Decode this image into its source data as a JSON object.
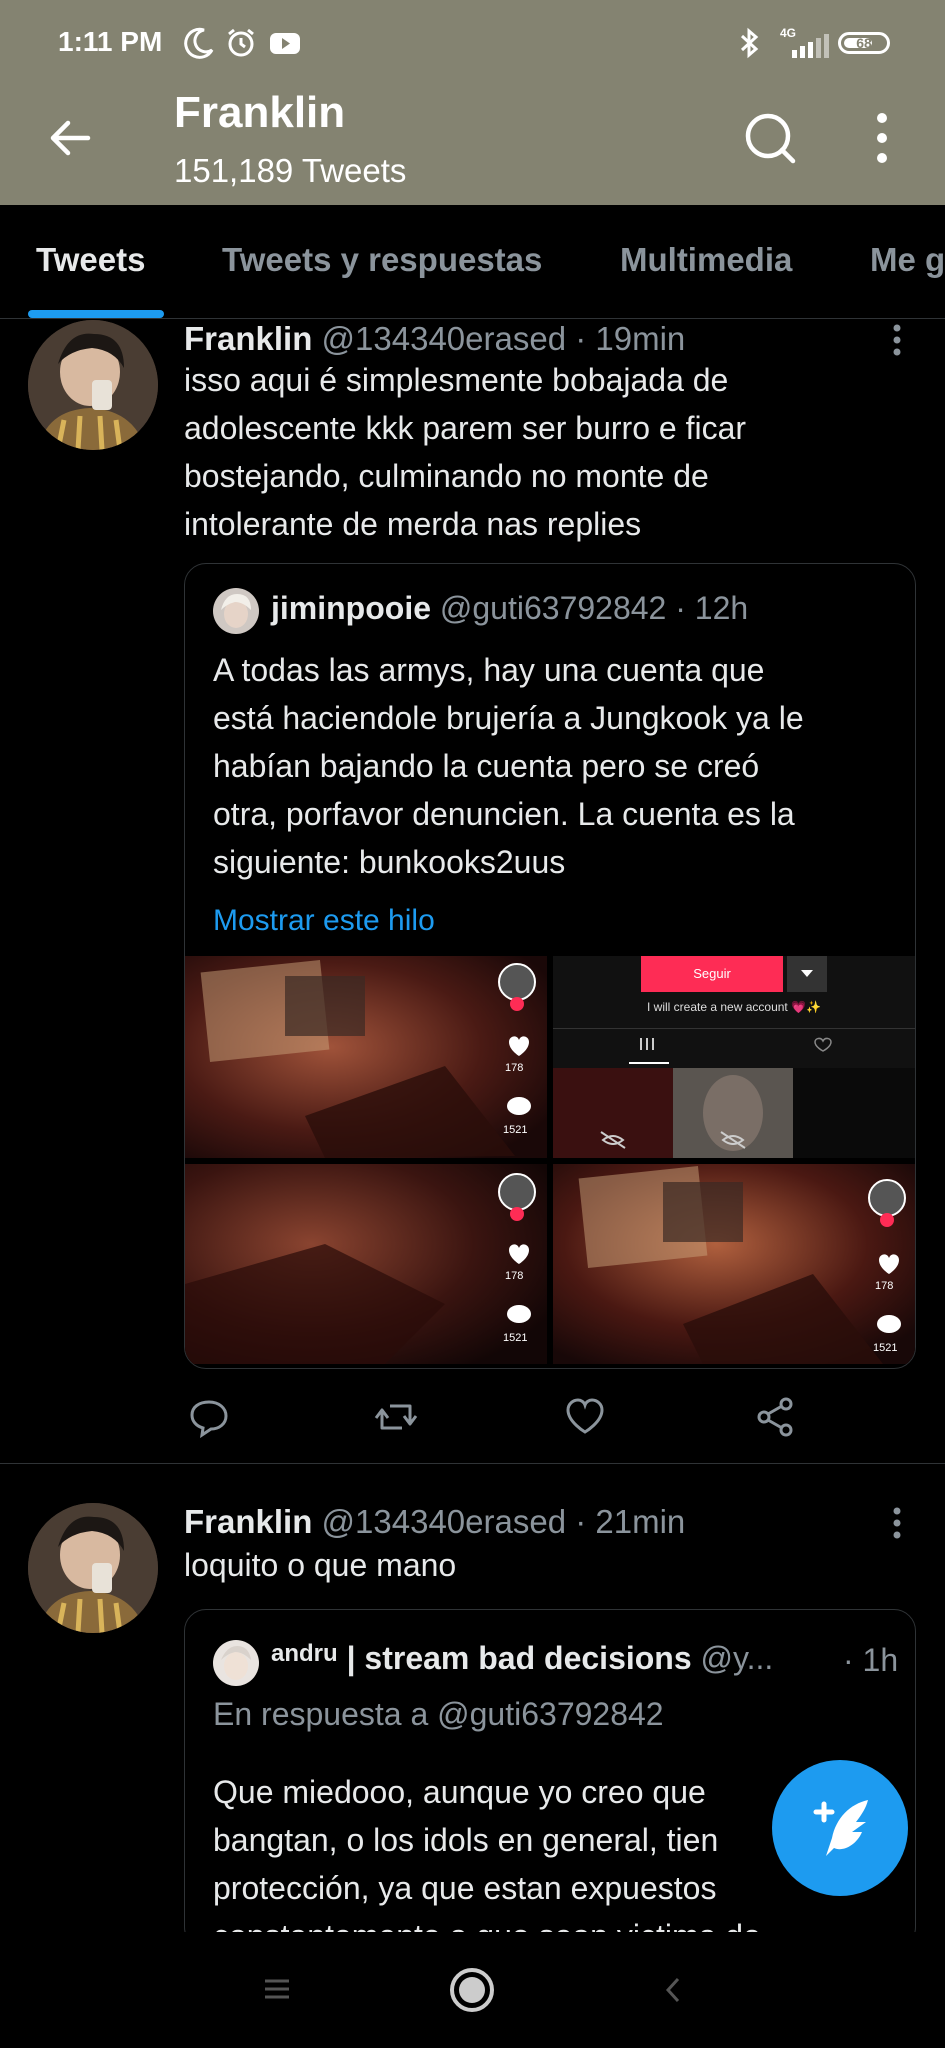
{
  "status_bar": {
    "time": "1:11 PM",
    "network": "4G",
    "battery": "68"
  },
  "header": {
    "title": "Franklin",
    "subtitle": "151,189 Tweets"
  },
  "tabs": [
    {
      "label": "Tweets",
      "active": true
    },
    {
      "label": "Tweets y respuestas",
      "active": false
    },
    {
      "label": "Multimedia",
      "active": false
    },
    {
      "label": "Me g",
      "active": false
    }
  ],
  "tweets": [
    {
      "author": "Franklin",
      "meta": "@134340erased · 19min",
      "lines": [
        "isso aqui é simplesmente bobajada de",
        "adolescente kkk parem ser burro e ficar",
        "bostejando, culminando no monte de",
        "intolerante de merda nas replies"
      ],
      "quote": {
        "author": "jiminpooie",
        "meta": "@guti63792842 · 12h",
        "lines": [
          "A todas las armys, hay una cuenta que",
          "está haciendole brujería a Jungkook ya le",
          "habían bajando la cuenta pero se creó",
          "otra, porfavor denuncien. La cuenta es la",
          "siguiente: bunkooks2uus"
        ],
        "show_thread": "Mostrar este hilo",
        "media": {
          "likes": "178",
          "comments": "1521",
          "follow_label": "Seguir",
          "account_text": "I will create a new account 💗✨"
        }
      }
    },
    {
      "author": "Franklin",
      "meta": "@134340erased · 21min",
      "lines": [
        "loquito o que mano"
      ],
      "quote": {
        "author_prefix": "andru",
        "author": "| stream bad decisions",
        "handle": "@y...",
        "time": "· 1h",
        "reply_to": "En respuesta a @guti63792842",
        "lines": [
          "Que miedooo, aunque yo creo que",
          "bangtan, o los idols en general, tien",
          "protección, ya que estan expuestos",
          "constantemente a que sean victima de"
        ]
      }
    }
  ],
  "colors": {
    "header_bg": "#848371",
    "accent": "#1d9bf0",
    "follow": "#fe2c55"
  }
}
